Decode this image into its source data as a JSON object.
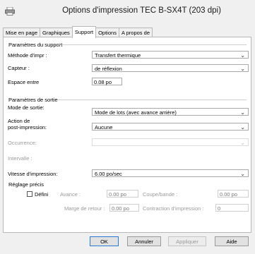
{
  "window": {
    "title": "Options d'impression TEC B-SX4T (203 dpi)"
  },
  "tabs": [
    {
      "label": "Mise en page"
    },
    {
      "label": "Graphiques"
    },
    {
      "label": "Support"
    },
    {
      "label": "Options"
    },
    {
      "label": "A propos de"
    }
  ],
  "support": {
    "group_title": "Paramètres du support",
    "method_label": "Méthode d'impr :",
    "method_value": "Transfert thermique",
    "sensor_label": "Capteur :",
    "sensor_value": "de réflexion",
    "gap_label": "Espace entre",
    "gap_value": "0.08 po"
  },
  "output": {
    "group_title": "Paramètres de sortie",
    "mode_label": "Mode de sortie:",
    "mode_value": "Mode de lots (avec avance arrière)",
    "post_label_line1": "Action de",
    "post_label_line2": "post-impression:",
    "post_value": "Aucune",
    "occurrence_label": "Occurrence:",
    "interval_label": "Intervalle :",
    "speed_label": "Vitesse d'impression:",
    "speed_value": "6.00 po/sec"
  },
  "fine": {
    "group_title": "Réglage précis",
    "defini_label": "Défini",
    "avance_label": "Avance :",
    "avance_value": "0.00 po",
    "coupe_label": "Coupe/bande :",
    "coupe_value": "0.00 po",
    "marge_label": "Marge de retour :",
    "marge_value": "0.00 po",
    "contraction_label": "Contraction d'impression :",
    "contraction_value": "0"
  },
  "buttons": {
    "ok": "OK",
    "annuler": "Annuler",
    "appliquer": "Appliquer",
    "aide": "Aide"
  },
  "icons": {
    "app": "printer-icon",
    "chevron": "⌄"
  }
}
